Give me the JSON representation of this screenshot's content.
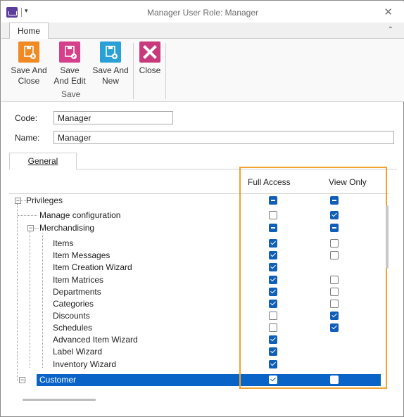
{
  "window": {
    "title": "Manager User Role: Manager",
    "close_glyph": "✕",
    "quick_access_glyph": "▾"
  },
  "ribbon": {
    "tab": "Home",
    "collapse_glyph": "⌃",
    "buttons": [
      {
        "label1": "Save And",
        "label2": "Close",
        "icon": "save-close-icon",
        "color": "#f08a24"
      },
      {
        "label1": "Save",
        "label2": "And Edit",
        "icon": "save-edit-icon",
        "color": "#d63f8a"
      },
      {
        "label1": "Save And",
        "label2": "New",
        "icon": "save-new-icon",
        "color": "#2aa0d8"
      },
      {
        "label1": "Close",
        "label2": "",
        "icon": "close-icon",
        "color": "#c83a7c"
      }
    ],
    "group_label": "Save"
  },
  "form": {
    "code_label": "Code:",
    "code_value": "Manager",
    "name_label": "Name:",
    "name_value": "Manager"
  },
  "tabs": {
    "general": "General"
  },
  "columns": {
    "full_access": "Full Access",
    "view_only": "View Only"
  },
  "tree": [
    {
      "label": "Privileges",
      "full": "indeterminate",
      "view": "indeterminate"
    },
    {
      "label": "Manage configuration",
      "full": "unchecked",
      "view": "checked"
    },
    {
      "label": "Merchandising",
      "full": "indeterminate",
      "view": "indeterminate"
    },
    {
      "label": "Items",
      "full": "checked",
      "view": "unchecked"
    },
    {
      "label": "Item Messages",
      "full": "checked",
      "view": "unchecked"
    },
    {
      "label": "Item Creation Wizard",
      "full": "checked",
      "view": "none"
    },
    {
      "label": "Item Matrices",
      "full": "checked",
      "view": "unchecked"
    },
    {
      "label": "Departments",
      "full": "checked",
      "view": "unchecked"
    },
    {
      "label": "Categories",
      "full": "checked",
      "view": "unchecked"
    },
    {
      "label": "Discounts",
      "full": "unchecked",
      "view": "checked"
    },
    {
      "label": "Schedules",
      "full": "unchecked",
      "view": "checked"
    },
    {
      "label": "Advanced Item Wizard",
      "full": "checked",
      "view": "none"
    },
    {
      "label": "Label Wizard",
      "full": "checked",
      "view": "none"
    },
    {
      "label": "Inventory Wizard",
      "full": "checked",
      "view": "none"
    },
    {
      "label": "Customer",
      "full": "checked",
      "view": "unchecked",
      "selected": true
    }
  ],
  "colors": {
    "selection": "#0a64c8",
    "checkbox_checked": "#0f5eb8",
    "highlight": "#f0a22e"
  }
}
